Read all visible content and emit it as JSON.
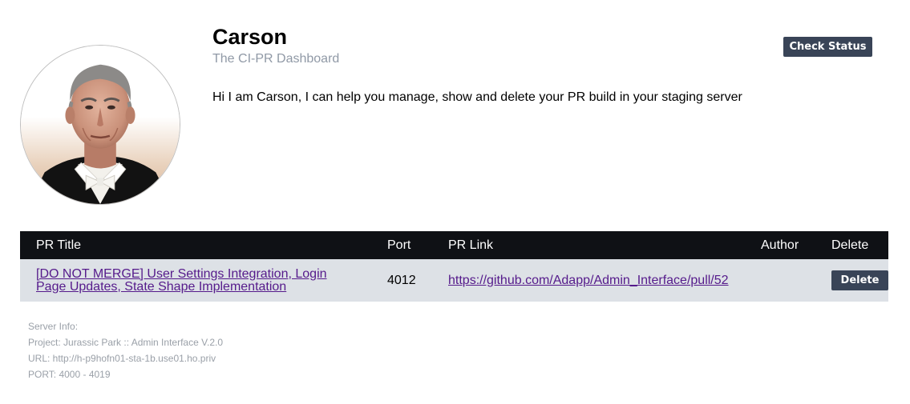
{
  "header": {
    "name": "Carson",
    "subtitle": "The CI-PR Dashboard",
    "intro": "Hi I am Carson, I can help you manage, show and delete your PR build in your staging server",
    "check_status_label": "Check Status",
    "avatar_icon": "butler-portrait"
  },
  "table": {
    "columns": [
      "PR Title",
      "Port",
      "PR Link",
      "Author",
      "Delete"
    ],
    "rows": [
      {
        "title": "[DO NOT MERGE] User Settings Integration, Login Page Updates, State Shape Implementation",
        "port": "4012",
        "link": "https://github.com/Adapp/Admin_Interface/pull/52",
        "author": "",
        "delete_label": "Delete"
      }
    ]
  },
  "server_info": {
    "heading": "Server Info:",
    "project": "Project: Jurassic Park :: Admin Interface V.2.0",
    "url": "URL: http://h-p9hofn01-sta-1b.use01.ho.priv",
    "port": "PORT: 4000 - 4019"
  },
  "colors": {
    "button_bg": "#394457",
    "table_header_bg": "#0f1115",
    "table_row_bg": "#dde1e6",
    "subtitle": "#9099a6",
    "link": "#551a8b",
    "muted_text": "#9aa0a8"
  }
}
